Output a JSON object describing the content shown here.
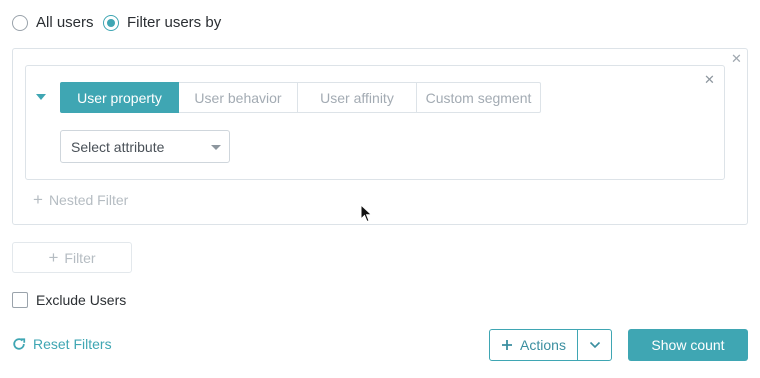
{
  "audience": {
    "options": [
      {
        "label": "All users",
        "selected": false
      },
      {
        "label": "Filter users by",
        "selected": true
      }
    ]
  },
  "filter_group": {
    "tabs": [
      {
        "label": "User property",
        "active": true
      },
      {
        "label": "User behavior",
        "active": false
      },
      {
        "label": "User affinity",
        "active": false
      },
      {
        "label": "Custom segment",
        "active": false
      }
    ],
    "attribute_select": {
      "value": "Select attribute"
    },
    "close_icon": "close-icon"
  },
  "nested_filter_label": "Nested Filter",
  "add_filter_label": "Filter",
  "exclude_users_label": "Exclude Users",
  "exclude_users_checked": false,
  "footer": {
    "reset_label": "Reset Filters",
    "actions_label": "Actions",
    "show_count_label": "Show count"
  },
  "colors": {
    "accent": "#3fa6b3",
    "border": "#dde3e8",
    "muted_text": "#a3abb3"
  }
}
